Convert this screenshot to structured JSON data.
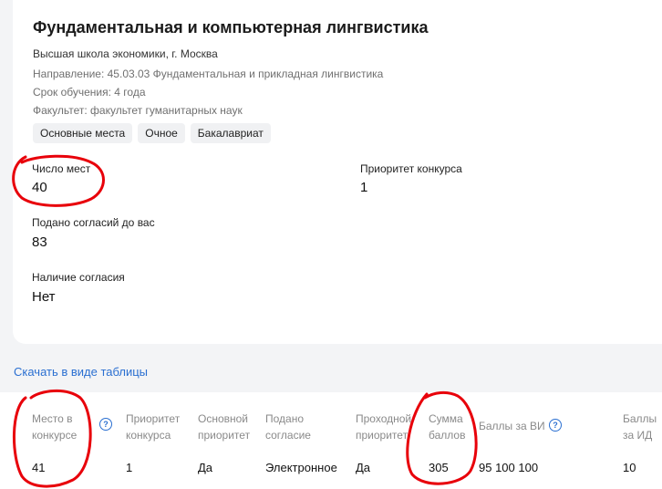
{
  "program": {
    "title": "Фундаментальная и компьютерная лингвистика",
    "university": "Высшая школа экономики, г. Москва",
    "direction": "Направление: 45.03.03 Фундаментальная и прикладная лингвистика",
    "duration": "Срок обучения: 4 года",
    "faculty": "Факультет: факультет гуманитарных наук",
    "tags": [
      "Основные места",
      "Очное",
      "Бакалавриат"
    ]
  },
  "stats": {
    "places_label": "Число мест",
    "places_value": "40",
    "priority_label": "Приоритет конкурса",
    "priority_value": "1",
    "consents_label": "Подано согласий до вас",
    "consents_value": "83",
    "consent_label": "Наличие согласия",
    "consent_value": "Нет"
  },
  "download_link": "Скачать в виде таблицы",
  "table": {
    "headers": {
      "place": "Место в конкурсе",
      "priority": "Приоритет конкурса",
      "main_priority": "Основной приоритет",
      "consent": "Подано согласие",
      "passing_priority": "Проходной приоритет",
      "score_sum": "Сумма баллов",
      "vi_scores": "Баллы за ВИ",
      "id_scores": "Баллы за ИД"
    },
    "row": {
      "place": "41",
      "priority": "1",
      "main_priority": "Да",
      "consent": "Электронное",
      "passing_priority": "Да",
      "score_sum": "305",
      "vi_scores": "95 100 100",
      "id_scores": "10"
    }
  },
  "colors": {
    "accent": "#2a6fd1",
    "annotation": "#e8000a"
  },
  "icons": [
    "help-icon"
  ]
}
